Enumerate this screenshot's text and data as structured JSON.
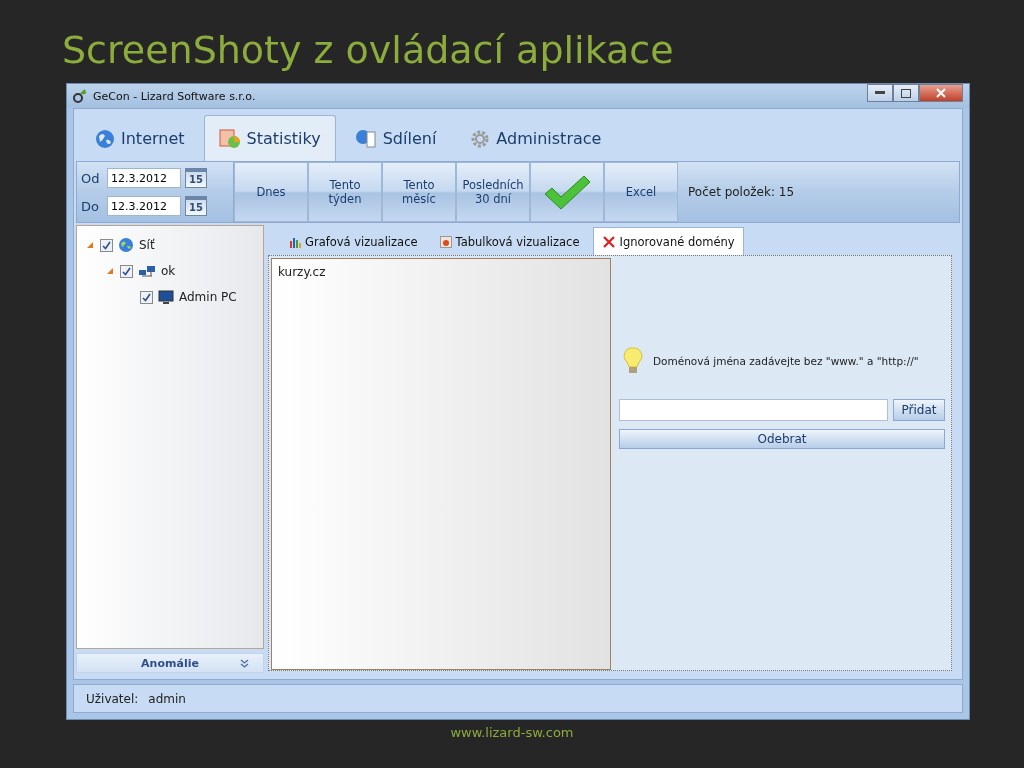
{
  "slide": {
    "title": "ScreenShoty z ovládací aplikace",
    "footer": "www.lizard-sw.com"
  },
  "window": {
    "title": "GeCon - Lizard Software s.r.o."
  },
  "tabs": [
    {
      "label": "Internet",
      "selected": false
    },
    {
      "label": "Statistiky",
      "selected": true
    },
    {
      "label": "Sdílení",
      "selected": false
    },
    {
      "label": "Administrace",
      "selected": false
    }
  ],
  "date_range": [
    {
      "label": "Od",
      "value": "12.3.2012",
      "calendar_day": "15"
    },
    {
      "label": "Do",
      "value": "12.3.2012",
      "calendar_day": "15"
    }
  ],
  "toolbar_buttons": [
    {
      "kind": "text",
      "label": "Dnes"
    },
    {
      "kind": "text",
      "label": "Tento týden"
    },
    {
      "kind": "text",
      "label": "Tento měsíc"
    },
    {
      "kind": "text",
      "label": "Posledních 30 dní"
    },
    {
      "kind": "confirm"
    },
    {
      "kind": "text",
      "label": "Excel"
    }
  ],
  "item_count": "Počet položek: 15",
  "tree": [
    {
      "label": "Síť",
      "checked": true,
      "expanded": true,
      "children": [
        {
          "label": "ok",
          "checked": true,
          "expanded": true,
          "children": [
            {
              "label": "Admin PC",
              "checked": true
            }
          ]
        }
      ]
    }
  ],
  "sidebar_footer": {
    "label": "Anomálie"
  },
  "subtabs": [
    {
      "label": "Grafová vizualizace",
      "selected": false
    },
    {
      "label": "Tabulková vizualizace",
      "selected": false
    },
    {
      "label": "Ignorované domény",
      "selected": true
    }
  ],
  "domains": [
    "kurzy.cz"
  ],
  "hint": "Doménová jména zadávejte bez \"www.\" a \"http://\"",
  "add_button": "Přidat",
  "remove_button": "Odebrat",
  "status_bar": {
    "label": "Uživatel:",
    "value": "admin"
  }
}
